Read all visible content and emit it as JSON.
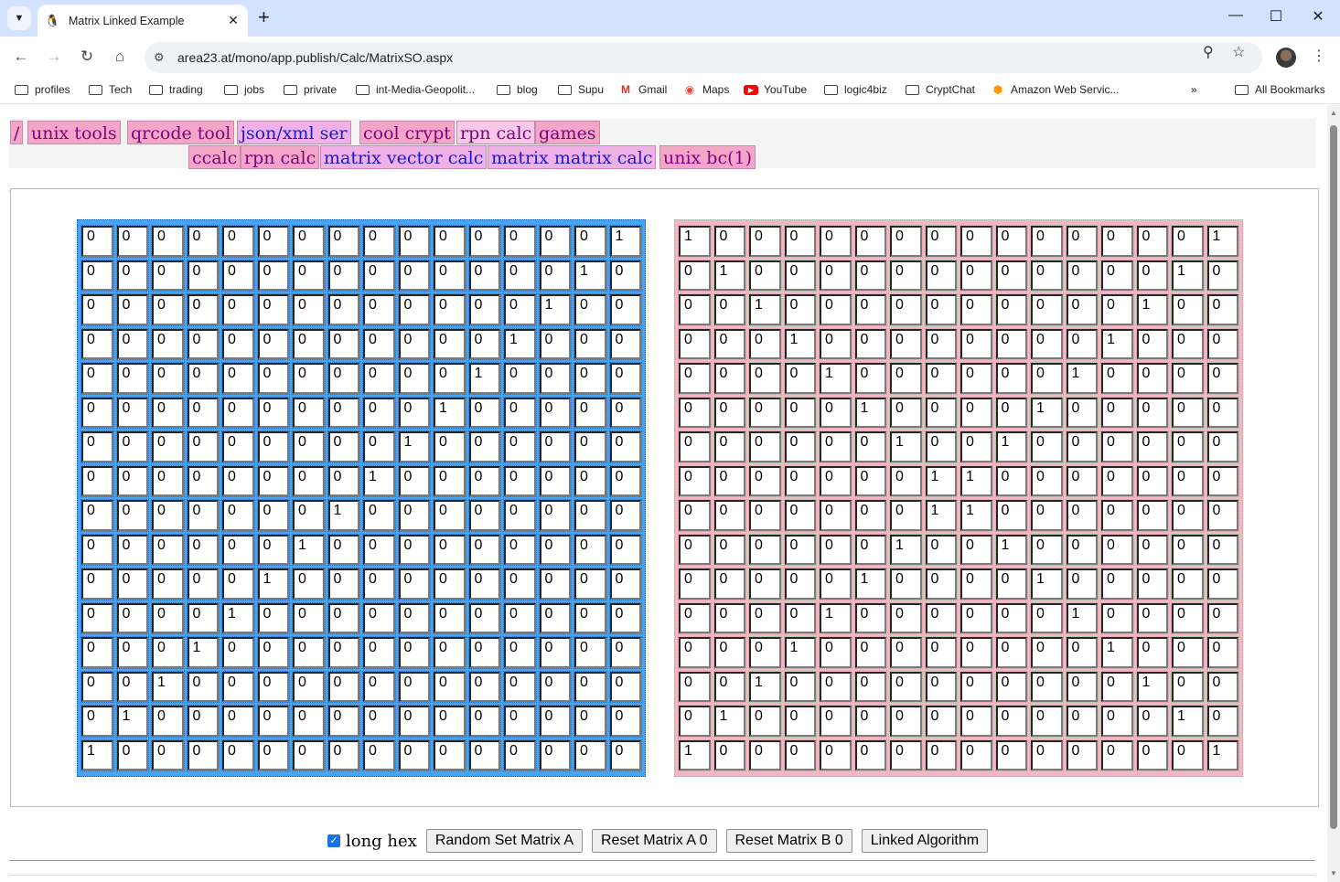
{
  "browser": {
    "tab_title": "Matrix Linked Example",
    "url": "area23.at/mono/app.publish/Calc/MatrixSO.aspx",
    "bookmarks": [
      {
        "label": "profiles",
        "icon": "folder-icon"
      },
      {
        "label": "Tech",
        "icon": "folder-icon"
      },
      {
        "label": "trading",
        "icon": "folder-icon"
      },
      {
        "label": "jobs",
        "icon": "folder-icon"
      },
      {
        "label": "private",
        "icon": "folder-icon"
      },
      {
        "label": "int-Media-Geopolit...",
        "icon": "folder-icon"
      },
      {
        "label": "blog",
        "icon": "folder-icon"
      },
      {
        "label": "Supu",
        "icon": "folder-icon"
      },
      {
        "label": "Gmail",
        "icon": "gmail-icon"
      },
      {
        "label": "Maps",
        "icon": "maps-icon"
      },
      {
        "label": "YouTube",
        "icon": "youtube-icon"
      },
      {
        "label": "logic4biz",
        "icon": "folder-icon"
      },
      {
        "label": "CryptChat",
        "icon": "folder-icon"
      },
      {
        "label": "Amazon Web Servic...",
        "icon": "aws-icon"
      }
    ],
    "all_bookmarks": "All Bookmarks"
  },
  "menu": {
    "row1": [
      "/",
      "unix tools",
      "qrcode tool",
      "json/xml ser",
      "cool crypt",
      "rpn calc",
      "games"
    ],
    "row2": [
      "ccalc",
      "rpn calc",
      "matrix vector calc",
      "matrix matrix calc",
      "unix bc(1)"
    ]
  },
  "matrix_a": [
    [
      "0",
      "0",
      "0",
      "0",
      "0",
      "0",
      "0",
      "0",
      "0",
      "0",
      "0",
      "0",
      "0",
      "0",
      "0",
      "1"
    ],
    [
      "0",
      "0",
      "0",
      "0",
      "0",
      "0",
      "0",
      "0",
      "0",
      "0",
      "0",
      "0",
      "0",
      "0",
      "1",
      "0"
    ],
    [
      "0",
      "0",
      "0",
      "0",
      "0",
      "0",
      "0",
      "0",
      "0",
      "0",
      "0",
      "0",
      "0",
      "1",
      "0",
      "0"
    ],
    [
      "0",
      "0",
      "0",
      "0",
      "0",
      "0",
      "0",
      "0",
      "0",
      "0",
      "0",
      "0",
      "1",
      "0",
      "0",
      "0"
    ],
    [
      "0",
      "0",
      "0",
      "0",
      "0",
      "0",
      "0",
      "0",
      "0",
      "0",
      "0",
      "1",
      "0",
      "0",
      "0",
      "0"
    ],
    [
      "0",
      "0",
      "0",
      "0",
      "0",
      "0",
      "0",
      "0",
      "0",
      "0",
      "1",
      "0",
      "0",
      "0",
      "0",
      "0"
    ],
    [
      "0",
      "0",
      "0",
      "0",
      "0",
      "0",
      "0",
      "0",
      "0",
      "1",
      "0",
      "0",
      "0",
      "0",
      "0",
      "0"
    ],
    [
      "0",
      "0",
      "0",
      "0",
      "0",
      "0",
      "0",
      "0",
      "1",
      "0",
      "0",
      "0",
      "0",
      "0",
      "0",
      "0"
    ],
    [
      "0",
      "0",
      "0",
      "0",
      "0",
      "0",
      "0",
      "1",
      "0",
      "0",
      "0",
      "0",
      "0",
      "0",
      "0",
      "0"
    ],
    [
      "0",
      "0",
      "0",
      "0",
      "0",
      "0",
      "1",
      "0",
      "0",
      "0",
      "0",
      "0",
      "0",
      "0",
      "0",
      "0"
    ],
    [
      "0",
      "0",
      "0",
      "0",
      "0",
      "1",
      "0",
      "0",
      "0",
      "0",
      "0",
      "0",
      "0",
      "0",
      "0",
      "0"
    ],
    [
      "0",
      "0",
      "0",
      "0",
      "1",
      "0",
      "0",
      "0",
      "0",
      "0",
      "0",
      "0",
      "0",
      "0",
      "0",
      "0"
    ],
    [
      "0",
      "0",
      "0",
      "1",
      "0",
      "0",
      "0",
      "0",
      "0",
      "0",
      "0",
      "0",
      "0",
      "0",
      "0",
      "0"
    ],
    [
      "0",
      "0",
      "1",
      "0",
      "0",
      "0",
      "0",
      "0",
      "0",
      "0",
      "0",
      "0",
      "0",
      "0",
      "0",
      "0"
    ],
    [
      "0",
      "1",
      "0",
      "0",
      "0",
      "0",
      "0",
      "0",
      "0",
      "0",
      "0",
      "0",
      "0",
      "0",
      "0",
      "0"
    ],
    [
      "1",
      "0",
      "0",
      "0",
      "0",
      "0",
      "0",
      "0",
      "0",
      "0",
      "0",
      "0",
      "0",
      "0",
      "0",
      "0"
    ]
  ],
  "matrix_b": [
    [
      "1",
      "0",
      "0",
      "0",
      "0",
      "0",
      "0",
      "0",
      "0",
      "0",
      "0",
      "0",
      "0",
      "0",
      "0",
      "1"
    ],
    [
      "0",
      "1",
      "0",
      "0",
      "0",
      "0",
      "0",
      "0",
      "0",
      "0",
      "0",
      "0",
      "0",
      "0",
      "1",
      "0"
    ],
    [
      "0",
      "0",
      "1",
      "0",
      "0",
      "0",
      "0",
      "0",
      "0",
      "0",
      "0",
      "0",
      "0",
      "1",
      "0",
      "0"
    ],
    [
      "0",
      "0",
      "0",
      "1",
      "0",
      "0",
      "0",
      "0",
      "0",
      "0",
      "0",
      "0",
      "1",
      "0",
      "0",
      "0"
    ],
    [
      "0",
      "0",
      "0",
      "0",
      "1",
      "0",
      "0",
      "0",
      "0",
      "0",
      "0",
      "1",
      "0",
      "0",
      "0",
      "0"
    ],
    [
      "0",
      "0",
      "0",
      "0",
      "0",
      "1",
      "0",
      "0",
      "0",
      "0",
      "1",
      "0",
      "0",
      "0",
      "0",
      "0"
    ],
    [
      "0",
      "0",
      "0",
      "0",
      "0",
      "0",
      "1",
      "0",
      "0",
      "1",
      "0",
      "0",
      "0",
      "0",
      "0",
      "0"
    ],
    [
      "0",
      "0",
      "0",
      "0",
      "0",
      "0",
      "0",
      "1",
      "1",
      "0",
      "0",
      "0",
      "0",
      "0",
      "0",
      "0"
    ],
    [
      "0",
      "0",
      "0",
      "0",
      "0",
      "0",
      "0",
      "1",
      "1",
      "0",
      "0",
      "0",
      "0",
      "0",
      "0",
      "0"
    ],
    [
      "0",
      "0",
      "0",
      "0",
      "0",
      "0",
      "1",
      "0",
      "0",
      "1",
      "0",
      "0",
      "0",
      "0",
      "0",
      "0"
    ],
    [
      "0",
      "0",
      "0",
      "0",
      "0",
      "1",
      "0",
      "0",
      "0",
      "0",
      "1",
      "0",
      "0",
      "0",
      "0",
      "0"
    ],
    [
      "0",
      "0",
      "0",
      "0",
      "1",
      "0",
      "0",
      "0",
      "0",
      "0",
      "0",
      "1",
      "0",
      "0",
      "0",
      "0"
    ],
    [
      "0",
      "0",
      "0",
      "1",
      "0",
      "0",
      "0",
      "0",
      "0",
      "0",
      "0",
      "0",
      "1",
      "0",
      "0",
      "0"
    ],
    [
      "0",
      "0",
      "1",
      "0",
      "0",
      "0",
      "0",
      "0",
      "0",
      "0",
      "0",
      "0",
      "0",
      "1",
      "0",
      "0"
    ],
    [
      "0",
      "1",
      "0",
      "0",
      "0",
      "0",
      "0",
      "0",
      "0",
      "0",
      "0",
      "0",
      "0",
      "0",
      "1",
      "0"
    ],
    [
      "1",
      "0",
      "0",
      "0",
      "0",
      "0",
      "0",
      "0",
      "0",
      "0",
      "0",
      "0",
      "0",
      "0",
      "0",
      "1"
    ]
  ],
  "controls": {
    "long_hex_label": "long hex",
    "long_hex_checked": true,
    "random_a": "Random Set Matrix A",
    "reset_a": "Reset Matrix A 0",
    "reset_b": "Reset Matrix B 0",
    "linked": "Linked Algorithm"
  },
  "colors": {
    "matrix_a_bg": "#4aa3f0",
    "matrix_b_bg": "#f4b6c2",
    "menu_bg": "#f4a6c8",
    "tab_strip": "#d3e3fd"
  }
}
